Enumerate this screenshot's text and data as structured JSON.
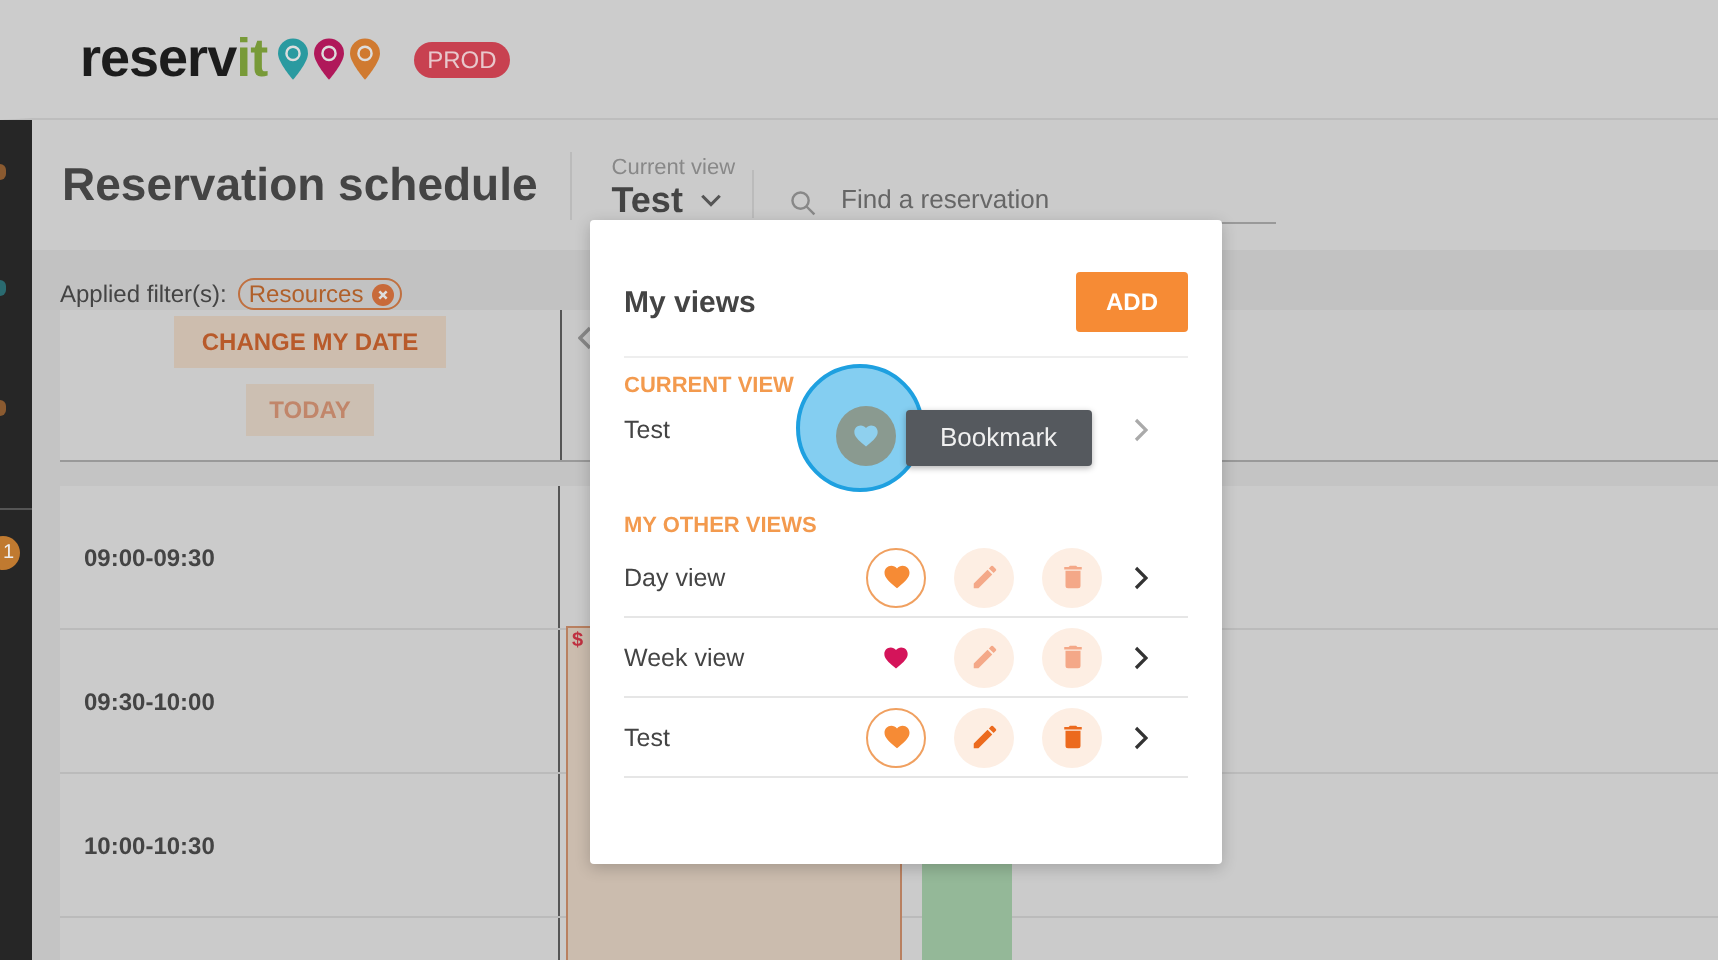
{
  "header": {
    "logo": {
      "main": "reserv",
      "accent": "it"
    },
    "env_badge": "PROD"
  },
  "sidebar": {
    "badge": "1"
  },
  "page": {
    "title": "Reservation schedule",
    "current_view": {
      "label": "Current view",
      "value": "Test"
    },
    "search": {
      "placeholder": "Find a reservation"
    }
  },
  "filters": {
    "label": "Applied filter(s):",
    "chips": [
      "Resources"
    ]
  },
  "date_controls": [
    {
      "label": "CHANGE MY DATE",
      "kind": "primary"
    },
    {
      "label": "TODAY",
      "kind": "secondary"
    }
  ],
  "schedule": {
    "rows": [
      "09:00-09:30",
      "09:30-10:00",
      "10:00-10:30"
    ],
    "reservation": {
      "symbol": "$"
    }
  },
  "views_panel": {
    "title": "My views",
    "add_button": "ADD",
    "current": {
      "heading": "CURRENT VIEW",
      "name": "Test",
      "tooltip": "Bookmark"
    },
    "others": {
      "heading": "MY OTHER VIEWS",
      "items": [
        {
          "name": "Day view",
          "default": false,
          "editable": false
        },
        {
          "name": "Week view",
          "default": true,
          "editable": false
        },
        {
          "name": "Test",
          "default": false,
          "editable": true
        }
      ]
    }
  }
}
